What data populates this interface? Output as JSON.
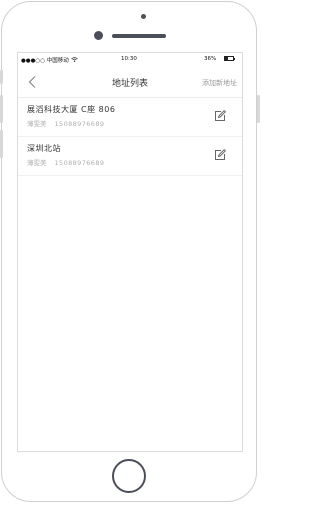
{
  "status_bar": {
    "carrier": "●●●○○ 中国移动",
    "time": "10:30",
    "battery_text": "36%",
    "battery_level": 0.36
  },
  "navbar": {
    "title": "地址列表",
    "add_label": "添加新地址"
  },
  "addresses": [
    {
      "name": "展滔科技大厦 C座 806",
      "contact": "薄雯美",
      "phone": "15088976689"
    },
    {
      "name": "深圳北站",
      "contact": "薄雯美",
      "phone": "15088976689"
    }
  ],
  "icons": [
    "back-chevron-icon",
    "wifi-icon",
    "battery-icon",
    "edit-icon"
  ]
}
